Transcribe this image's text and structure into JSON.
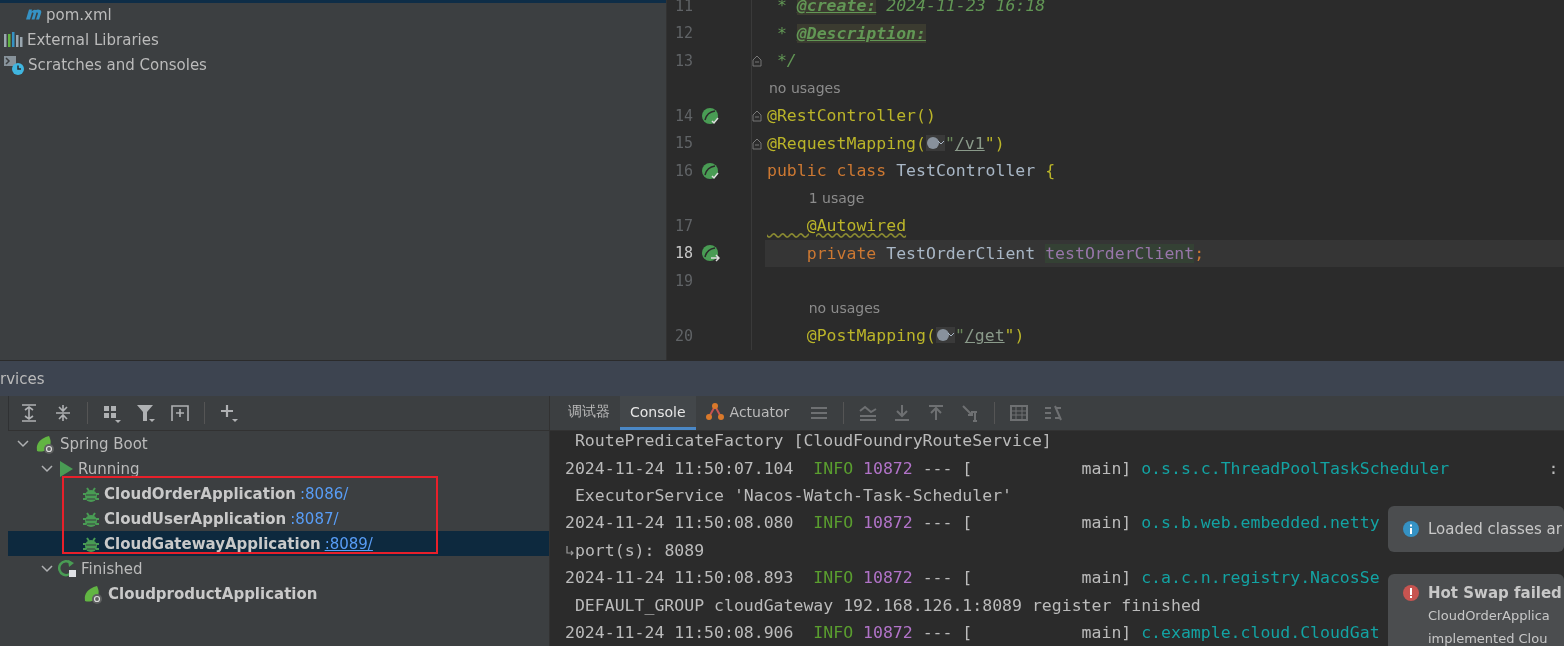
{
  "project_tree": [
    {
      "label": "pom.xml",
      "kind": "maven"
    },
    {
      "label": "External Libraries",
      "kind": "libraries"
    },
    {
      "label": "Scratches and Consoles",
      "kind": "scratches"
    }
  ],
  "editor": {
    "lines": [
      {
        "number": "11",
        "current": false,
        "fold": false,
        "kind": "plain",
        "tokens": [
          {
            "text": " * ",
            "kind": "comment"
          },
          {
            "text": "@create:",
            "kind": "doctag"
          },
          {
            "text": " 2024-11-23 16:18",
            "kind": "comment"
          }
        ]
      },
      {
        "number": "12",
        "current": false,
        "fold": false,
        "kind": "plain",
        "tokens": [
          {
            "text": " * ",
            "kind": "comment"
          },
          {
            "text": "@Description:",
            "kind": "doctag"
          }
        ]
      },
      {
        "number": "13",
        "current": false,
        "fold": true,
        "kind": "plain",
        "tokens": [
          {
            "text": " */",
            "kind": "comment"
          }
        ]
      },
      {
        "number": "14",
        "current": false,
        "fold": true,
        "kind": "bean",
        "hint": "no usages",
        "tokens": [
          {
            "text": "@RestController()",
            "kind": "annotation"
          }
        ]
      },
      {
        "number": "15",
        "current": false,
        "fold": true,
        "kind": "plain",
        "tokens": [
          {
            "text": "@RequestMapping(",
            "kind": "annotation"
          },
          {
            "kind": "inlay"
          },
          {
            "text": "\"",
            "kind": "string"
          },
          {
            "text": "/v1",
            "kind": "url"
          },
          {
            "text": "\")",
            "kind": "annotation"
          }
        ]
      },
      {
        "number": "16",
        "current": false,
        "fold": false,
        "kind": "bean",
        "tokens": [
          {
            "text": "public class ",
            "kind": "keyword"
          },
          {
            "text": "TestController ",
            "kind": "plain"
          },
          {
            "text": "{",
            "kind": "annotation"
          }
        ]
      },
      {
        "number": "17",
        "current": false,
        "fold": false,
        "kind": "plain",
        "hint": "1 usage",
        "tokens": [
          {
            "text": "    @Autowired",
            "kind": "warning"
          }
        ]
      },
      {
        "number": "18",
        "current": true,
        "fold": false,
        "kind": "inject",
        "tokens": [
          {
            "text": "    private ",
            "kind": "keyword"
          },
          {
            "text": "TestOrderClient ",
            "kind": "plain"
          },
          {
            "text": "testOrderClient",
            "kind": "field"
          },
          {
            "text": ";",
            "kind": "keyword"
          }
        ]
      },
      {
        "number": "19",
        "current": false,
        "fold": false,
        "kind": "plain"
      },
      {
        "number": "20",
        "current": false,
        "fold": false,
        "kind": "plain",
        "hint": "no usages",
        "tokens": [
          {
            "text": "    @PostMapping(",
            "kind": "annotation"
          },
          {
            "kind": "inlay"
          },
          {
            "text": "\"",
            "kind": "string"
          },
          {
            "text": "/get",
            "kind": "url"
          },
          {
            "text": "\")",
            "kind": "annotation"
          }
        ]
      }
    ]
  },
  "services": {
    "title": "rvices",
    "tree": [
      {
        "label": "Spring Boot",
        "kind": "spring",
        "expanded": true,
        "selected": false,
        "children": [
          {
            "label": "Running",
            "kind": "running",
            "expanded": true,
            "selected": false,
            "children": [
              {
                "label": "CloudOrderApplication",
                "kind": "debug",
                "port": ":8086/",
                "selected": false
              },
              {
                "label": "CloudUserApplication",
                "kind": "debug",
                "port": ":8087/",
                "selected": false
              },
              {
                "label": "CloudGatewayApplication",
                "kind": "debug",
                "port": ":8089/",
                "selected": true
              }
            ]
          },
          {
            "label": "Finished",
            "kind": "finished",
            "expanded": true,
            "selected": false,
            "children": [
              {
                "label": "CloudproductApplication",
                "kind": "spring",
                "selected": false
              }
            ]
          }
        ]
      }
    ]
  },
  "console": {
    "tabs": [
      {
        "label": "调试器",
        "selected": false
      },
      {
        "label": "Console",
        "selected": true
      },
      {
        "label": "Actuator",
        "selected": false
      }
    ],
    "lines": [
      {
        "wrapped": false,
        "tokens": [
          {
            "text": " RoutePredicateFactory [CloudFoundryRouteService]",
            "kind": "plain"
          }
        ]
      },
      {
        "wrapped": false,
        "tokens": [
          {
            "text": "2024-11-24 11:50:07.104  ",
            "kind": "plain"
          },
          {
            "text": "INFO ",
            "kind": "level"
          },
          {
            "text": "10872",
            "kind": "pid"
          },
          {
            "text": " --- [           main] ",
            "kind": "plain"
          },
          {
            "text": "o.s.s.c.ThreadPoolTaskScheduler",
            "kind": "logger"
          },
          {
            "text": "          :",
            "kind": "plain"
          }
        ]
      },
      {
        "wrapped": false,
        "tokens": [
          {
            "text": " ExecutorService 'Nacos-Watch-Task-Scheduler'",
            "kind": "plain"
          }
        ]
      },
      {
        "wrapped": false,
        "tokens": [
          {
            "text": "2024-11-24 11:50:08.080  ",
            "kind": "plain"
          },
          {
            "text": "INFO ",
            "kind": "level"
          },
          {
            "text": "10872",
            "kind": "pid"
          },
          {
            "text": " --- [           main] ",
            "kind": "plain"
          },
          {
            "text": "o.s.b.web.embedded.netty",
            "kind": "logger"
          }
        ]
      },
      {
        "wrapped": true,
        "tokens": [
          {
            "text": "port(s): 8089",
            "kind": "plain"
          }
        ]
      },
      {
        "wrapped": false,
        "tokens": [
          {
            "text": "2024-11-24 11:50:08.893  ",
            "kind": "plain"
          },
          {
            "text": "INFO ",
            "kind": "level"
          },
          {
            "text": "10872",
            "kind": "pid"
          },
          {
            "text": " --- [           main] ",
            "kind": "plain"
          },
          {
            "text": "c.a.c.n.registry.NacosSe",
            "kind": "logger"
          }
        ]
      },
      {
        "wrapped": false,
        "tokens": [
          {
            "text": " DEFAULT_GROUP cloudGateway 192.168.126.1:8089 register finished",
            "kind": "plain"
          }
        ]
      },
      {
        "wrapped": false,
        "tokens": [
          {
            "text": "2024-11-24 11:50:08.906  ",
            "kind": "plain"
          },
          {
            "text": "INFO ",
            "kind": "level"
          },
          {
            "text": "10872",
            "kind": "pid"
          },
          {
            "text": " --- [           main] ",
            "kind": "plain"
          },
          {
            "text": "c.example.cloud.CloudGat",
            "kind": "logger"
          }
        ]
      }
    ]
  },
  "notifications": [
    {
      "kind": "info",
      "lines": [
        "Loaded classes ar"
      ]
    },
    {
      "kind": "error",
      "title": "Hot Swap failed",
      "lines": [
        "CloudOrderApplica",
        "implemented Clou"
      ]
    }
  ]
}
